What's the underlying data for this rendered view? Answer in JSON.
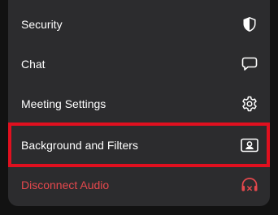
{
  "menu": {
    "items": [
      {
        "label": "Security",
        "icon": "shield-icon"
      },
      {
        "label": "Chat",
        "icon": "chat-bubble-icon"
      },
      {
        "label": "Meeting Settings",
        "icon": "gear-icon"
      },
      {
        "label": "Background and Filters",
        "icon": "portrait-frame-icon"
      },
      {
        "label": "Disconnect Audio",
        "icon": "headphones-disconnect-icon"
      }
    ]
  },
  "colors": {
    "panel": "#2c2c2e",
    "text": "#ffffff",
    "danger": "#e5484d",
    "highlight": "#e0101f"
  }
}
